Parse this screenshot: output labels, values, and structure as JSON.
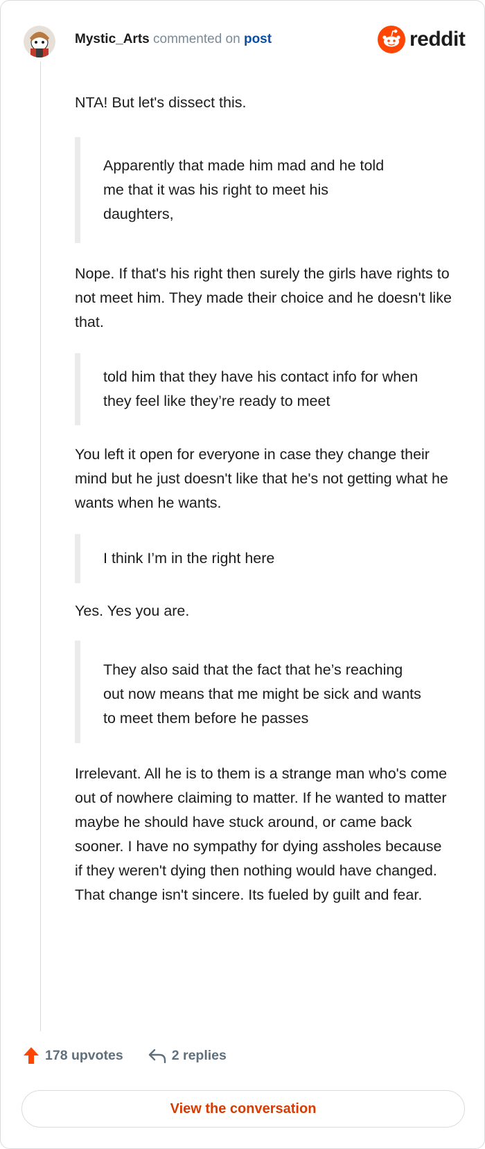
{
  "header": {
    "username": "Mystic_Arts",
    "commented_on": "commented on",
    "post_link": "post",
    "brand": "reddit"
  },
  "comment": {
    "p1": "NTA! But let's dissect this.",
    "q1": "Apparently that made him mad and he told me that it was his right to meet his daughters,",
    "p2": "Nope. If that's his right then surely the girls have rights to not meet him. They made their choice and he doesn't like that.",
    "q2": "told him that they have his contact info for when they feel like they’re ready to meet",
    "p3": "You left it open for everyone in case they change their mind but he just doesn't like that he's not getting what he wants when he wants.",
    "q3": "I think I’m in the right here",
    "p4": "Yes. Yes you are.",
    "q4": "They also said that the fact that he’s reaching out now means that me might be sick and wants to meet them before he passes",
    "p5": "Irrelevant. All he is to them is a strange man who's come out of nowhere claiming to matter. If he wanted to matter maybe he should have stuck around, or came back sooner. I have no sympathy for dying assholes because if they weren't dying then nothing would have changed. That change isn't sincere. Its fueled by guilt and fear."
  },
  "footer": {
    "upvotes": "178 upvotes",
    "replies": "2 replies",
    "view_button": "View the conversation"
  },
  "colors": {
    "accent": "#ff4500",
    "link": "#0a4ea3",
    "button_text": "#d93a00",
    "quote_bar": "#e9ebec"
  }
}
